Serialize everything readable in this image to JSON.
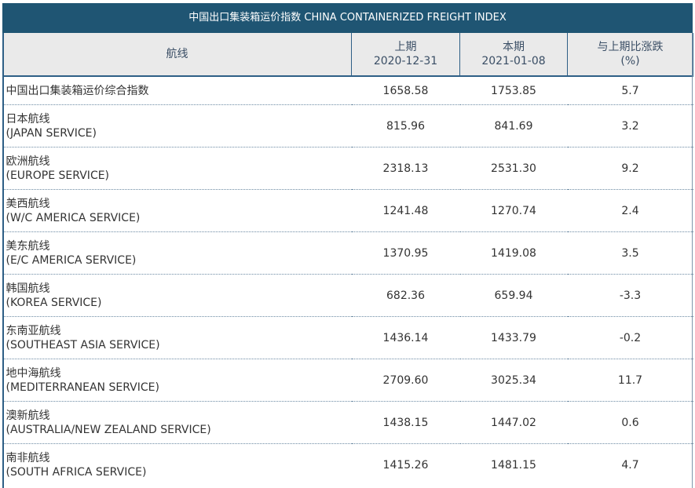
{
  "title": "中国出口集装箱运价指数 CHINA CONTAINERIZED FREIGHT INDEX",
  "header": {
    "route": "航线",
    "prev_label": "上期",
    "prev_date": "2020-12-31",
    "curr_label": "本期",
    "curr_date": "2021-01-08",
    "change_label": "与上期比涨跌",
    "change_unit": "(%)"
  },
  "rows": [
    {
      "name": "中国出口集装箱运价综合指数",
      "sub": "",
      "prev": "1658.58",
      "curr": "1753.85",
      "change": "5.7"
    },
    {
      "name": "日本航线",
      "sub": "(JAPAN SERVICE)",
      "prev": "815.96",
      "curr": "841.69",
      "change": "3.2"
    },
    {
      "name": "欧洲航线",
      "sub": "(EUROPE SERVICE)",
      "prev": "2318.13",
      "curr": "2531.30",
      "change": "9.2"
    },
    {
      "name": "美西航线",
      "sub": "(W/C AMERICA SERVICE)",
      "prev": "1241.48",
      "curr": "1270.74",
      "change": "2.4"
    },
    {
      "name": "美东航线",
      "sub": "(E/C AMERICA SERVICE)",
      "prev": "1370.95",
      "curr": "1419.08",
      "change": "3.5"
    },
    {
      "name": "韩国航线",
      "sub": "(KOREA SERVICE)",
      "prev": "682.36",
      "curr": "659.94",
      "change": "-3.3"
    },
    {
      "name": "东南亚航线",
      "sub": "(SOUTHEAST ASIA SERVICE)",
      "prev": "1436.14",
      "curr": "1433.79",
      "change": "-0.2"
    },
    {
      "name": "地中海航线",
      "sub": "(MEDITERRANEAN SERVICE)",
      "prev": "2709.60",
      "curr": "3025.34",
      "change": "11.7"
    },
    {
      "name": "澳新航线",
      "sub": "(AUSTRALIA/NEW ZEALAND SERVICE)",
      "prev": "1438.15",
      "curr": "1447.02",
      "change": "0.6"
    },
    {
      "name": "南非航线",
      "sub": "(SOUTH AFRICA SERVICE)",
      "prev": "1415.26",
      "curr": "1481.15",
      "change": "4.7"
    }
  ],
  "colors": {
    "title_bg": "#1f5573",
    "header_bg": "#eaeaea",
    "border": "#2e5f86"
  }
}
